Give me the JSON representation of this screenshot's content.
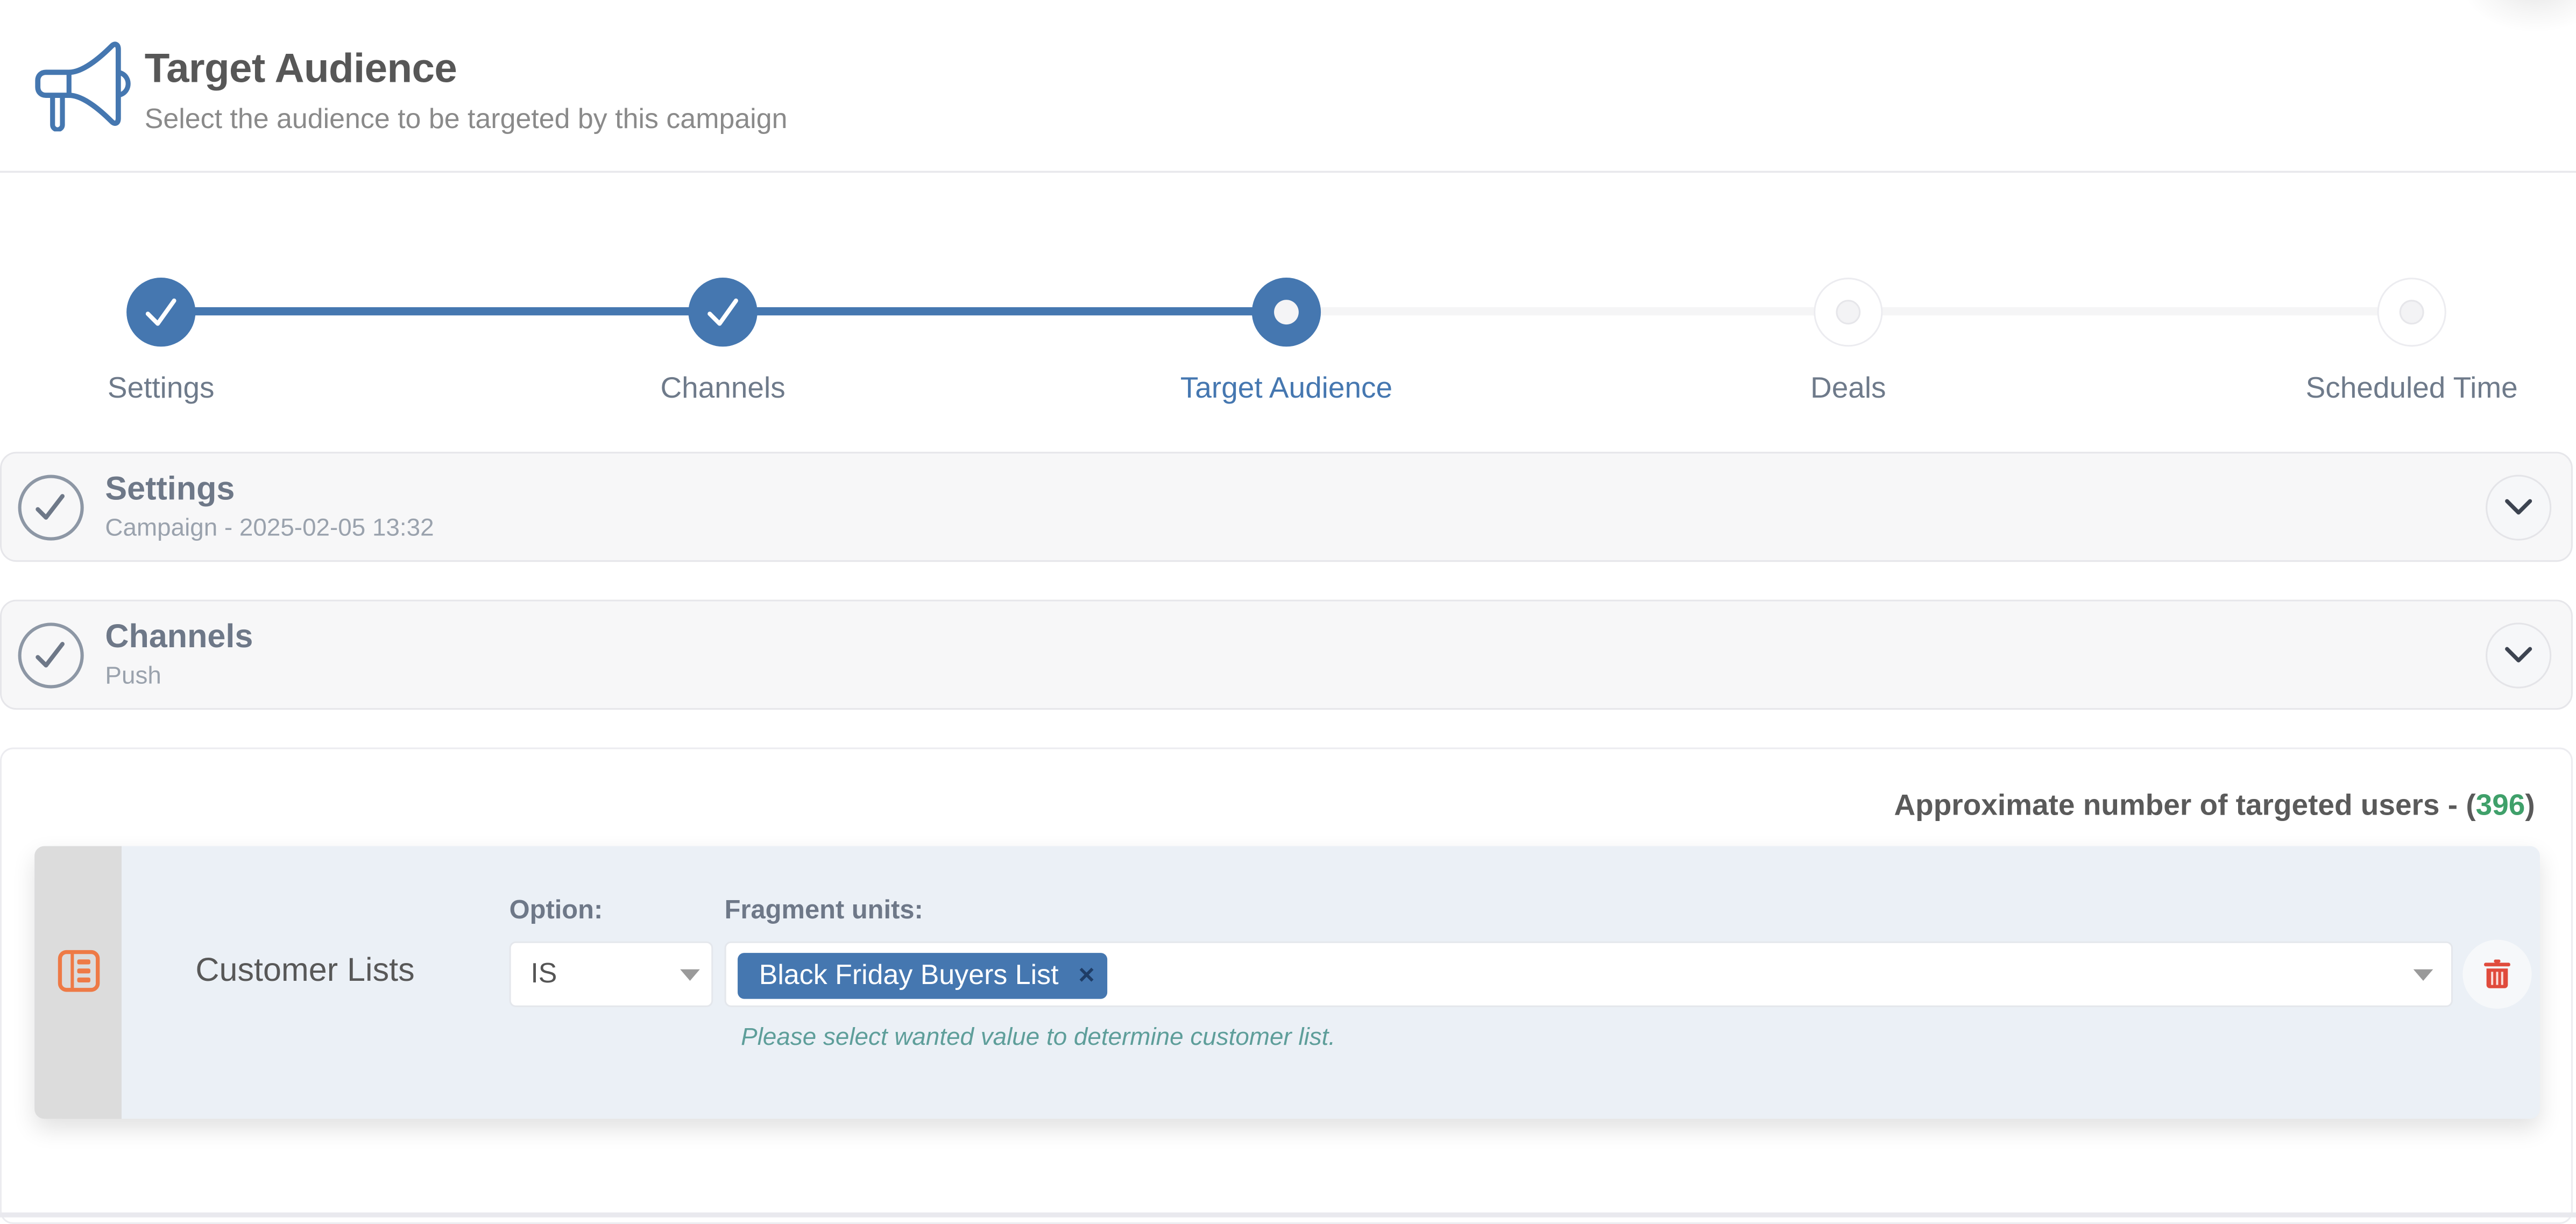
{
  "header": {
    "icon": "megaphone-icon",
    "title": "Target Audience",
    "subtitle": "Select the audience to be targeted by this campaign"
  },
  "stepper": {
    "current_step": 3,
    "total_steps": 5,
    "steps": [
      {
        "label": "Settings",
        "state": "done"
      },
      {
        "label": "Channels",
        "state": "done"
      },
      {
        "label": "Target Audience",
        "state": "active"
      },
      {
        "label": "Deals",
        "state": "todo"
      },
      {
        "label": "Scheduled Time",
        "state": "todo"
      }
    ]
  },
  "panels": [
    {
      "title": "Settings",
      "subtitle": "Campaign - 2025-02-05 13:32",
      "status_icon": "check-circle-icon",
      "toggle_icon": "chevron-down-icon"
    },
    {
      "title": "Channels",
      "subtitle": "Push",
      "status_icon": "check-circle-icon",
      "toggle_icon": "chevron-down-icon"
    }
  ],
  "audience": {
    "approx_label": "Approximate number of targeted users - (",
    "approx_count": "396",
    "approx_suffix": ")",
    "rules": [
      {
        "type_icon": "list-icon",
        "type_label": "Customer Lists",
        "option_label": "Option:",
        "option_value": "IS",
        "fragment_label": "Fragment units:",
        "selected_tags": [
          "Black Friday Buyers List"
        ],
        "tag_remove_glyph": "×",
        "help_text": "Please select wanted value to determine customer list.",
        "delete_icon": "trash-icon"
      }
    ]
  },
  "colors": {
    "accent": "#4577b0",
    "count_green": "#3fa06a",
    "delete_red": "#e04b3c",
    "rule_icon_orange": "#ee7a46",
    "help_teal": "#5e9e9a"
  }
}
